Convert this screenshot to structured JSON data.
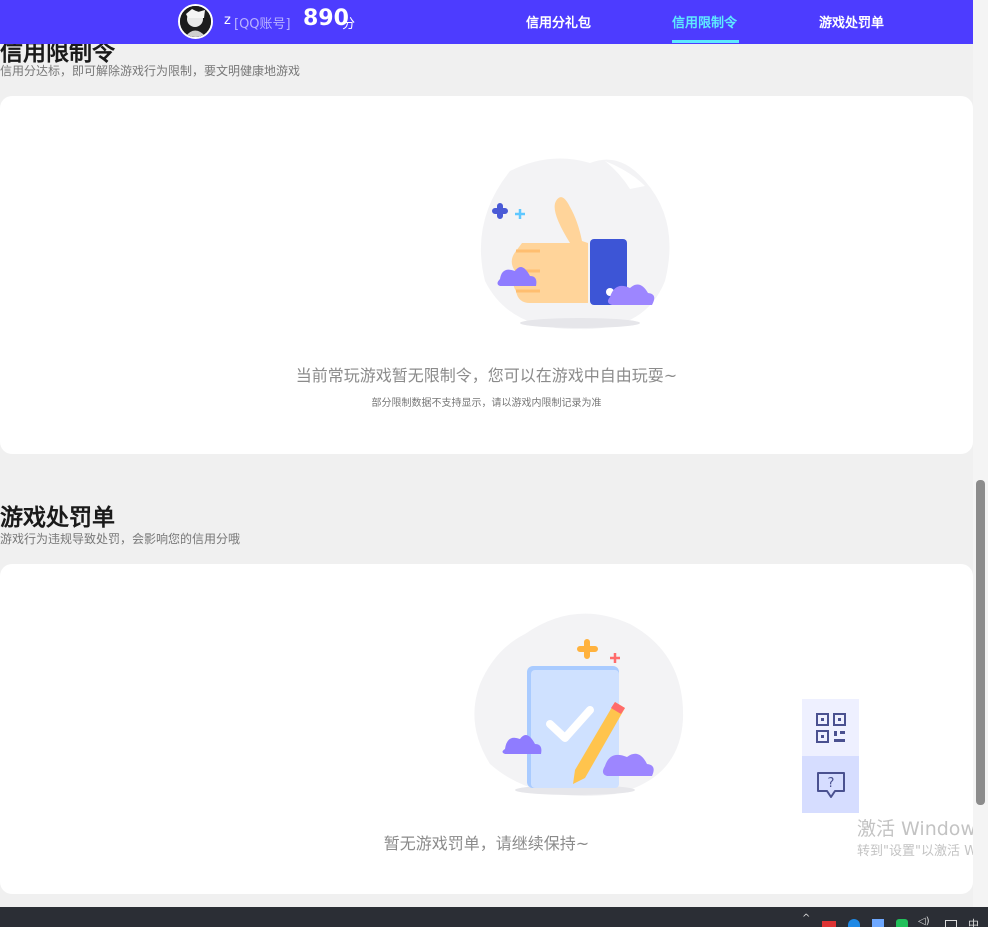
{
  "header": {
    "username": "z",
    "account_label": "[QQ账号]",
    "score": "890",
    "score_unit": "分",
    "nav": [
      {
        "label": "信用分礼包"
      },
      {
        "label": "信用限制令"
      },
      {
        "label": "游戏处罚单"
      }
    ],
    "active_tab": "信用限制令",
    "accent_color": "#4d3cff",
    "active_color": "#5ee9ff"
  },
  "restrictions": {
    "title": "信用限制令",
    "subtitle": "信用分达标，即可解除游戏行为限制，要文明健康地游戏",
    "empty_message": "当前常玩游戏暂无限制令，您可以在游戏中自由玩耍~",
    "note": "部分限制数据不支持显示，请以游戏内限制记录为准"
  },
  "penalties": {
    "title": "游戏处罚单",
    "subtitle": "游戏行为违规导致处罚，会影响您的信用分哦",
    "empty_message": "暂无游戏罚单，请继续保持~"
  },
  "watermark": {
    "line1": "激活 Windows",
    "line2": "转到\"设置\"以激活 W"
  },
  "taskbar": {
    "ime": "中"
  }
}
